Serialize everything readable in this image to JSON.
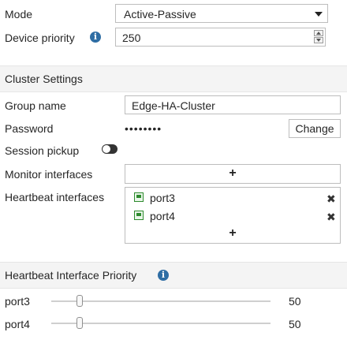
{
  "form": {
    "mode": {
      "label": "Mode",
      "value": "Active-Passive"
    },
    "device_priority": {
      "label": "Device priority",
      "value": "250"
    }
  },
  "cluster_settings": {
    "title": "Cluster Settings",
    "group_name": {
      "label": "Group name",
      "value": "Edge-HA-Cluster"
    },
    "password": {
      "label": "Password",
      "masked_value": "••••••••",
      "change_button_label": "Change"
    },
    "session_pickup": {
      "label": "Session pickup",
      "enabled": false
    },
    "monitor_interfaces": {
      "label": "Monitor interfaces",
      "add_icon": "+"
    },
    "heartbeat_interfaces": {
      "label": "Heartbeat interfaces",
      "items": [
        "port3",
        "port4"
      ],
      "remove_icon": "✖",
      "add_icon": "+"
    }
  },
  "heartbeat_priority": {
    "title": "Heartbeat Interface Priority",
    "rows": [
      {
        "port": "port3",
        "value": "50",
        "fraction": 0.12
      },
      {
        "port": "port4",
        "value": "50",
        "fraction": 0.12
      }
    ]
  },
  "colors": {
    "info_icon": "#2e6da4",
    "port_icon_green": "#2d8a2d",
    "section_background": "#f4f4f4"
  },
  "icons": {
    "info": "info-icon",
    "dropdown": "chevron-down-icon",
    "toggle": "toggle-off-icon",
    "port": "interface-port-icon",
    "remove": "close-icon",
    "add": "plus-icon"
  }
}
